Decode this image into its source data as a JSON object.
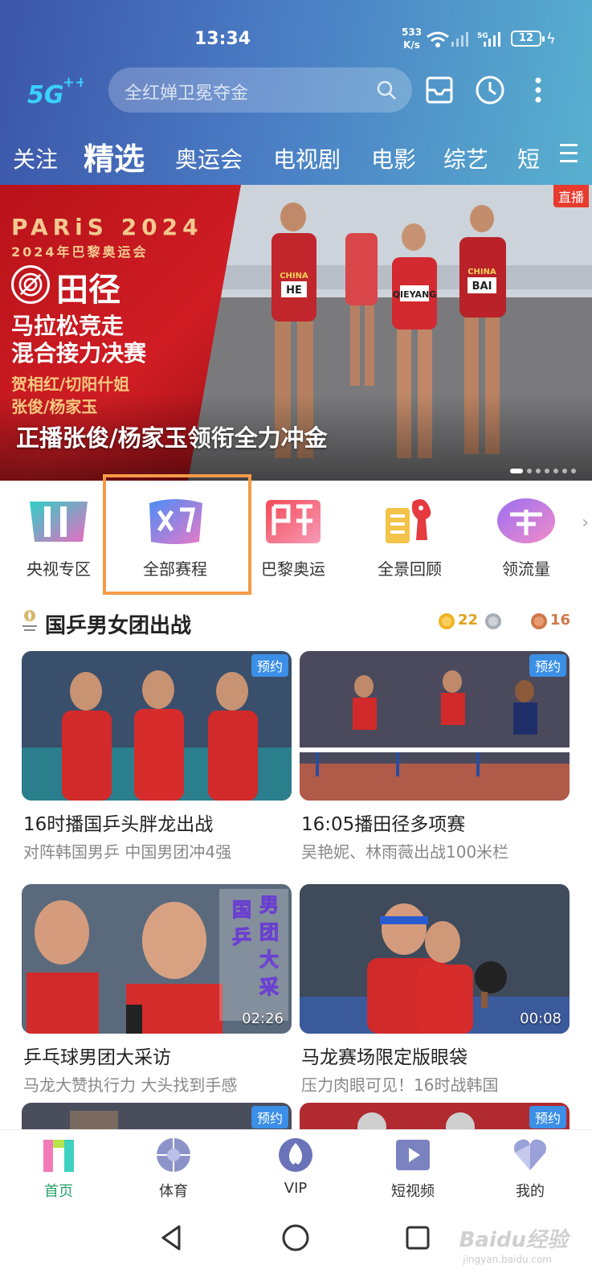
{
  "status_bar": {
    "time": "13:34",
    "speed_value": "533",
    "speed_unit": "K/s",
    "battery": "12"
  },
  "header": {
    "logo": "5G++",
    "search_placeholder": "全红婵卫冕夺金",
    "tabs": [
      "关注",
      "精选",
      "奥运会",
      "电视剧",
      "电影",
      "综艺",
      "短"
    ],
    "active_tab": "精选"
  },
  "banner": {
    "paris": "PARiS 2024",
    "paris_sub": "2024年巴黎奥运会",
    "sport": "田径",
    "event_line1": "马拉松竞走",
    "event_line2": "混合接力决赛",
    "athletes_line1": "贺相红/切阳什姐",
    "athletes_line2": "张俊/杨家玉",
    "live": "直播",
    "caption": "正播张俊/杨家玉领衔全力冲金",
    "bibs": [
      "CHINA",
      "HE",
      "QIEYANG",
      "CHINA",
      "BAI"
    ],
    "slides": 7
  },
  "quick_entries": [
    {
      "label": "央视专区",
      "icon": "cctv-zone-icon"
    },
    {
      "label": "全部赛程",
      "icon": "schedule-icon"
    },
    {
      "label": "巴黎奥运",
      "icon": "paris-olympics-icon"
    },
    {
      "label": "全景回顾",
      "icon": "panorama-review-icon"
    },
    {
      "label": "领流量",
      "icon": "data-bonus-icon"
    }
  ],
  "section": {
    "title": "国乒男女团出战",
    "medals": {
      "gold": "22",
      "bronze": "16"
    }
  },
  "cards": [
    {
      "title": "16时播国乒头胖龙出战",
      "subtitle": "对阵韩国男乒 中国男团冲4强",
      "badge": "预约"
    },
    {
      "title": "16:05播田径多项赛",
      "subtitle": "吴艳妮、林雨薇出战100米栏",
      "badge": "预约"
    },
    {
      "title": "乒乓球男团大采访",
      "subtitle": "马龙大赞执行力 大头找到手感",
      "duration": "02:26",
      "overlay": "国乒男团大采"
    },
    {
      "title": "马龙赛场限定版眼袋",
      "subtitle": "压力肉眼可见！16时战韩国",
      "duration": "00:08"
    },
    {
      "badge": "预约"
    },
    {
      "badge": "预约"
    }
  ],
  "bottom_nav": [
    {
      "label": "首页",
      "active": true
    },
    {
      "label": "体育"
    },
    {
      "label": "VIP"
    },
    {
      "label": "短视频"
    },
    {
      "label": "我的"
    }
  ],
  "watermark": {
    "main": "Baidu经验",
    "sub": "jingyan.baidu.com"
  },
  "colors": {
    "accent_green": "#2aa46a",
    "highlight_orange": "#f59a48",
    "badge_blue": "#3b8fe6",
    "live_red": "#e63b2e"
  }
}
